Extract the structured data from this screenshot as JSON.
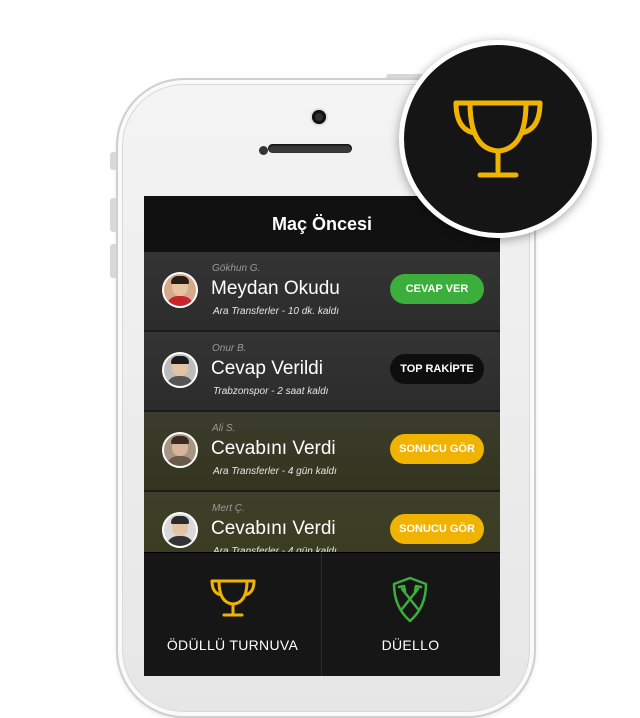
{
  "nav": {
    "title": "Maç Öncesi"
  },
  "rows": [
    {
      "user": "Gökhun G.",
      "status": "Meydan Okudu",
      "meta": "Ara Transferler - 10 dk. kaldı",
      "button": "CEVAP VER"
    },
    {
      "user": "Onur B.",
      "status": "Cevap Verildi",
      "meta": "Trabzonspor - 2 saat kaldı",
      "button": "TOP RAKİPTE"
    },
    {
      "user": "Ali S.",
      "status": "Cevabını Verdi",
      "meta": "Ara Transferler - 4 gün kaldı",
      "button": "SONUCU GÖR"
    },
    {
      "user": "Mert Ç.",
      "status": "Cevabını Verdi",
      "meta": "Ara Transferler - 4 gün kaldı",
      "button": "SONUCU GÖR"
    }
  ],
  "tabs": [
    {
      "label": "ÖDÜLLÜ TURNUVA",
      "icon": "trophy-icon"
    },
    {
      "label": "DÜELLO",
      "icon": "shield-axes-icon"
    }
  ],
  "colors": {
    "accent_yellow": "#f0b400",
    "cta_green": "#3cae3c",
    "duel_green": "#3cae3c"
  },
  "badge": {
    "icon": "trophy-icon"
  }
}
